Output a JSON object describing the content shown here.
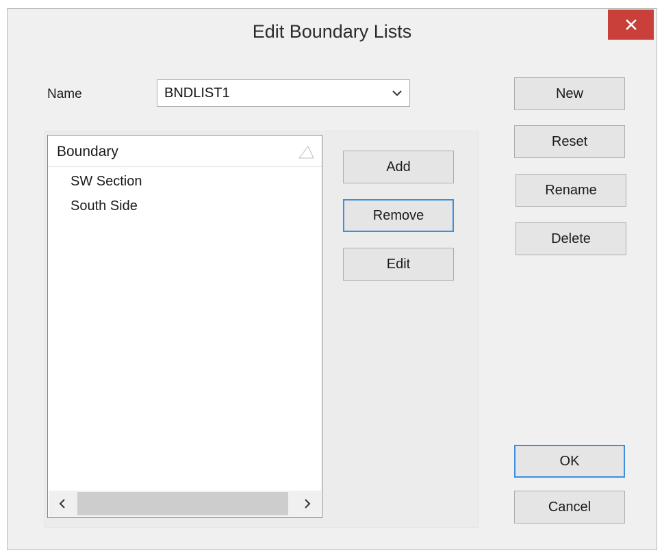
{
  "window": {
    "title": "Edit Boundary Lists"
  },
  "name_field": {
    "label": "Name",
    "value": "BNDLIST1"
  },
  "list": {
    "column_header": "Boundary",
    "items": [
      "SW Section",
      "South Side"
    ]
  },
  "middle_buttons": {
    "add": "Add",
    "remove": "Remove",
    "edit": "Edit"
  },
  "right_buttons": {
    "new": "New",
    "reset": "Reset",
    "rename": "Rename",
    "delete": "Delete"
  },
  "footer_buttons": {
    "ok": "OK",
    "cancel": "Cancel"
  },
  "icons": {
    "close": "close-icon",
    "dropdown": "chevron-down-icon",
    "sort": "sort-ascending-icon",
    "scroll_left": "chevron-left-icon",
    "scroll_right": "chevron-right-icon"
  },
  "colors": {
    "close_button": "#c9403a",
    "focus_border": "#3c8fe0",
    "dialog_background": "#f0f0f0"
  }
}
